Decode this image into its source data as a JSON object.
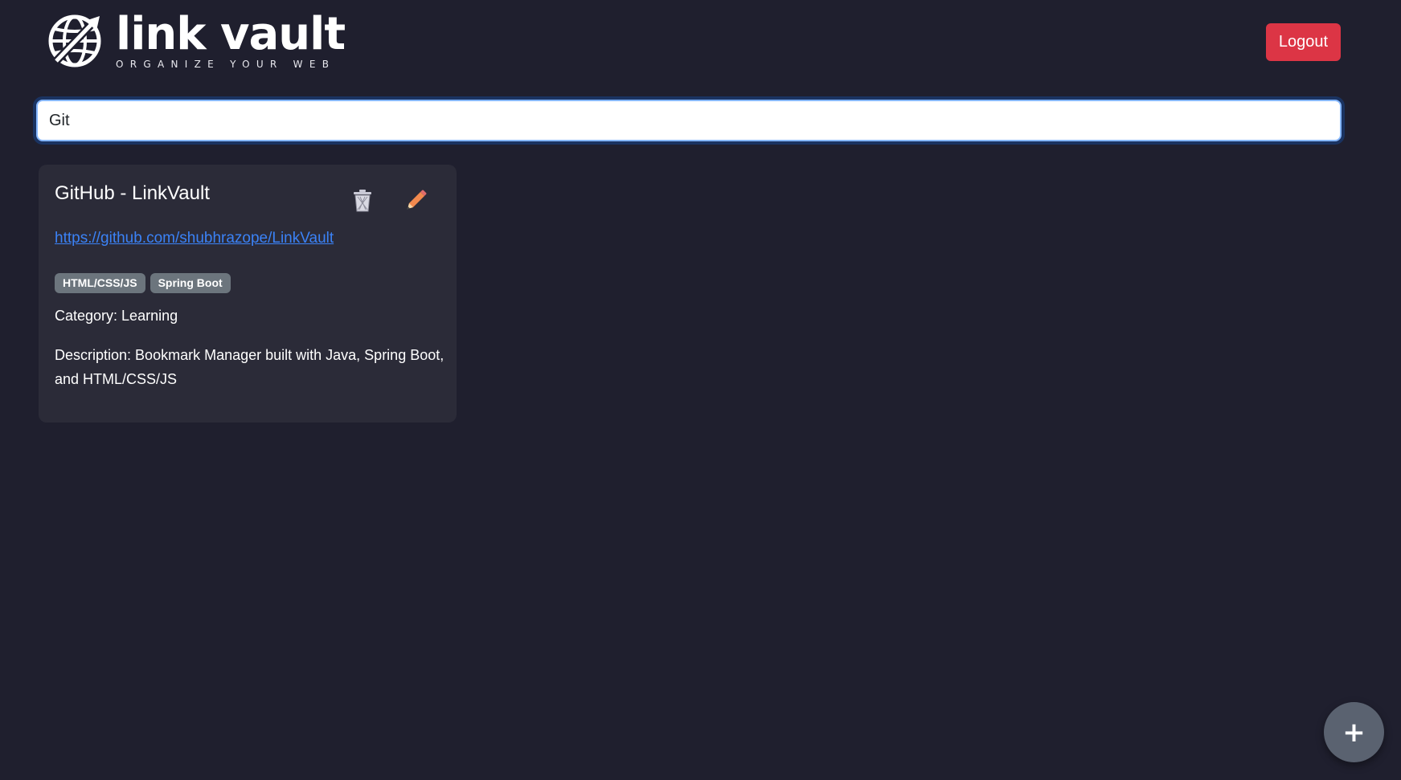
{
  "header": {
    "logo_title": "link vault",
    "logo_tagline": "ORGANIZE YOUR WEB",
    "logout_label": "Logout"
  },
  "search": {
    "value": "Git",
    "placeholder": ""
  },
  "bookmarks": [
    {
      "title": "GitHub - LinkVault",
      "url": "https://github.com/shubhrazope/LinkVault",
      "tags": [
        "HTML/CSS/JS",
        "Spring Boot"
      ],
      "category_prefix": "Category: ",
      "category": "Learning",
      "description_prefix": "Description: ",
      "description": "Bookmark Manager built with Java, Spring Boot, and HTML/CSS/JS",
      "delete_icon": "trash-icon",
      "edit_icon": "pencil-icon"
    }
  ],
  "fab": {
    "label": "+",
    "icon": "plus-icon"
  },
  "colors": {
    "background": "#1f1f2e",
    "card": "#2b2b38",
    "logout": "#dc3545",
    "link": "#3b82f6",
    "tag": "#6c757d",
    "fab": "#5a6270"
  }
}
